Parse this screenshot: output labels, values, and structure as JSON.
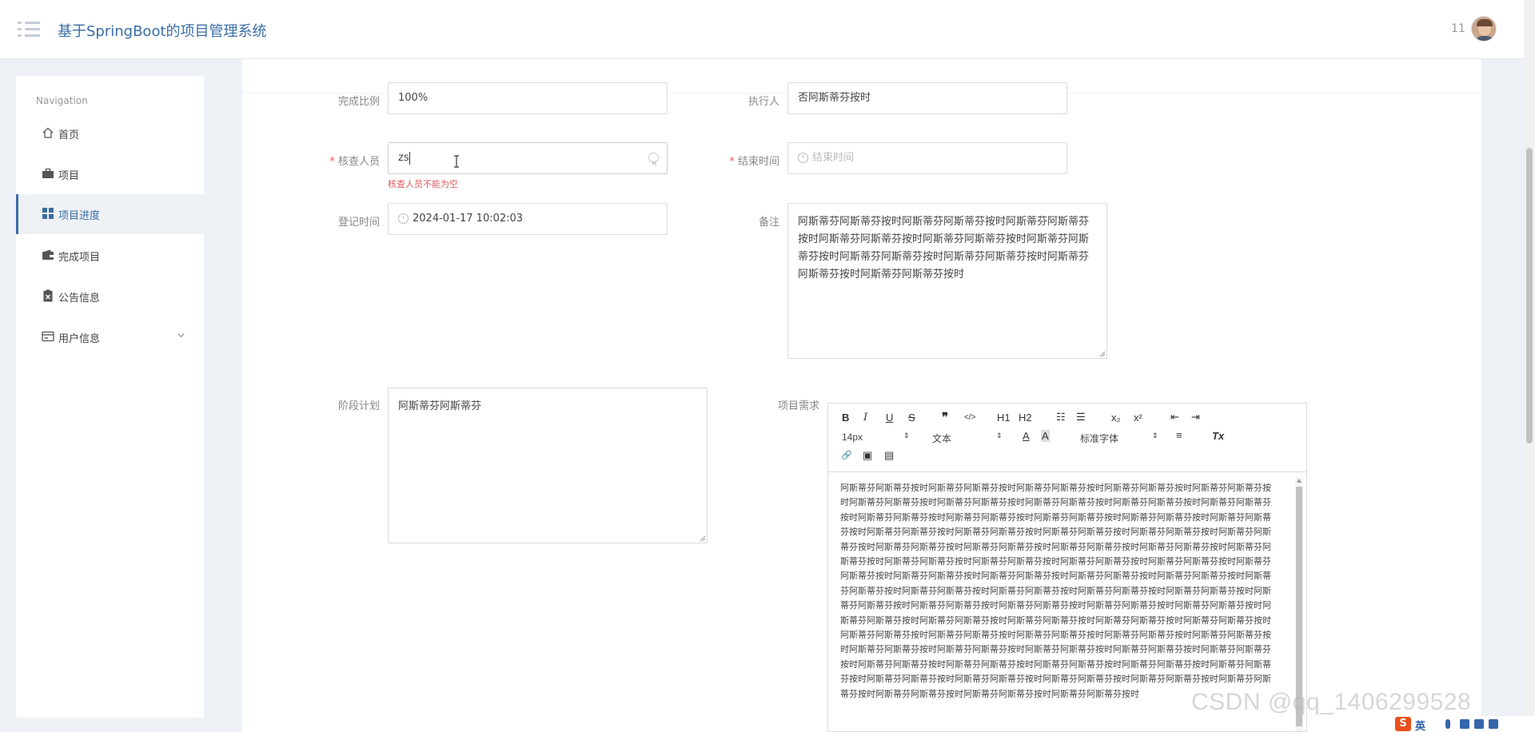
{
  "header": {
    "app_title": "基于SpringBoot的项目管理系统",
    "user_count": "11"
  },
  "sidebar": {
    "heading": "Navigation",
    "items": [
      {
        "label": "首页",
        "icon": "home-icon",
        "active": false
      },
      {
        "label": "项目",
        "icon": "briefcase-icon",
        "active": false
      },
      {
        "label": "项目进度",
        "icon": "grid-icon",
        "active": true
      },
      {
        "label": "完成项目",
        "icon": "wallet-icon",
        "active": false
      },
      {
        "label": "公告信息",
        "icon": "clipboard-x-icon",
        "active": false
      },
      {
        "label": "用户信息",
        "icon": "id-card-icon",
        "active": false,
        "has_submenu": true
      }
    ]
  },
  "form": {
    "completion_ratio": {
      "label": "完成比例",
      "value": "100%"
    },
    "executor": {
      "label": "执行人",
      "value": "否阿斯蒂芬按时"
    },
    "reviewer": {
      "required": "*",
      "label": "核查人员",
      "value": "zs",
      "error": "核查人员不能为空"
    },
    "end_time": {
      "required": "*",
      "label": "结束时间",
      "placeholder": "结束时间"
    },
    "register_time": {
      "label": "登记时间",
      "value": "2024-01-17 10:02:03"
    },
    "remarks": {
      "label": "备注",
      "value": "阿斯蒂芬阿斯蒂芬按时阿斯蒂芬阿斯蒂芬按时阿斯蒂芬阿斯蒂芬按时阿斯蒂芬阿斯蒂芬按时阿斯蒂芬阿斯蒂芬按时阿斯蒂芬阿斯蒂芬按时阿斯蒂芬阿斯蒂芬按时阿斯蒂芬阿斯蒂芬按时阿斯蒂芬阿斯蒂芬按时阿斯蒂芬阿斯蒂芬按时"
    },
    "stage_plan": {
      "label": "阶段计划",
      "value": "阿斯蒂芬阿斯蒂芬"
    },
    "requirements": {
      "label": "项目需求"
    }
  },
  "editor": {
    "toolbar": {
      "bold": "B",
      "italic": "I",
      "underline": "U",
      "strike": "S",
      "quote": "❞",
      "code": "</>",
      "h1": "H1",
      "h2": "H2",
      "ordered_list": "☷",
      "bullet_list": "☰",
      "subscript": "x₂",
      "superscript": "x²",
      "outdent": "⇤",
      "indent": "⇥",
      "size": "14px",
      "format": "文本",
      "color": "A",
      "background": "A",
      "font": "标准字体",
      "align": "≡",
      "clear": "Tx",
      "link": "🔗",
      "image": "▣",
      "video": "▤"
    },
    "content": "阿斯蒂芬阿斯蒂芬按时阿斯蒂芬阿斯蒂芬按时阿斯蒂芬阿斯蒂芬按时阿斯蒂芬阿斯蒂芬按时阿斯蒂芬阿斯蒂芬按时阿斯蒂芬阿斯蒂芬按时阿斯蒂芬阿斯蒂芬按时阿斯蒂芬阿斯蒂芬按时阿斯蒂芬阿斯蒂芬按时阿斯蒂芬阿斯蒂芬按时阿斯蒂芬阿斯蒂芬按时阿斯蒂芬阿斯蒂芬按时阿斯蒂芬阿斯蒂芬按时阿斯蒂芬阿斯蒂芬按时阿斯蒂芬阿斯蒂芬按时阿斯蒂芬阿斯蒂芬按时阿斯蒂芬阿斯蒂芬按时阿斯蒂芬阿斯蒂芬按时阿斯蒂芬阿斯蒂芬按时阿斯蒂芬阿斯蒂芬按时阿斯蒂芬阿斯蒂芬按时阿斯蒂芬阿斯蒂芬按时阿斯蒂芬阿斯蒂芬按时阿斯蒂芬阿斯蒂芬按时阿斯蒂芬阿斯蒂芬按时阿斯蒂芬阿斯蒂芬按时阿斯蒂芬阿斯蒂芬按时阿斯蒂芬阿斯蒂芬按时阿斯蒂芬阿斯蒂芬按时阿斯蒂芬阿斯蒂芬按时阿斯蒂芬阿斯蒂芬按时阿斯蒂芬阿斯蒂芬按时阿斯蒂芬阿斯蒂芬按时阿斯蒂芬阿斯蒂芬按时阿斯蒂芬阿斯蒂芬按时阿斯蒂芬阿斯蒂芬按时阿斯蒂芬阿斯蒂芬按时阿斯蒂芬阿斯蒂芬按时阿斯蒂芬阿斯蒂芬按时阿斯蒂芬阿斯蒂芬按时阿斯蒂芬阿斯蒂芬按时阿斯蒂芬阿斯蒂芬按时阿斯蒂芬阿斯蒂芬按时阿斯蒂芬阿斯蒂芬按时阿斯蒂芬阿斯蒂芬按时阿斯蒂芬阿斯蒂芬按时阿斯蒂芬阿斯蒂芬按时阿斯蒂芬阿斯蒂芬按时阿斯蒂芬阿斯蒂芬按时阿斯蒂芬阿斯蒂芬按时阿斯蒂芬阿斯蒂芬按时阿斯蒂芬阿斯蒂芬按时阿斯蒂芬阿斯蒂芬按时阿斯蒂芬阿斯蒂芬按时阿斯蒂芬阿斯蒂芬按时阿斯蒂芬阿斯蒂芬按时阿斯蒂芬阿斯蒂芬按时阿斯蒂芬阿斯蒂芬按时阿斯蒂芬阿斯蒂芬按时阿斯蒂芬阿斯蒂芬按时阿斯蒂芬阿斯蒂芬按时阿斯蒂芬阿斯蒂芬按时阿斯蒂芬阿斯蒂芬按时阿斯蒂芬阿斯蒂芬按时阿斯蒂芬阿斯蒂芬按时阿斯蒂芬阿斯蒂芬按时阿斯蒂芬阿斯蒂芬按时阿斯蒂芬阿斯蒂芬按时阿斯蒂芬阿斯蒂芬按时阿斯蒂芬阿斯蒂芬按时阿斯蒂芬阿斯蒂芬按时阿斯蒂芬阿斯蒂芬按时"
  },
  "overlay": {
    "watermark": "CSDN @qq_1406299528",
    "ime_logo": "S",
    "ime_lang": "英"
  },
  "colors": {
    "accent": "#3a6ea5",
    "error": "#e05a5a",
    "background": "#eef1f5"
  }
}
